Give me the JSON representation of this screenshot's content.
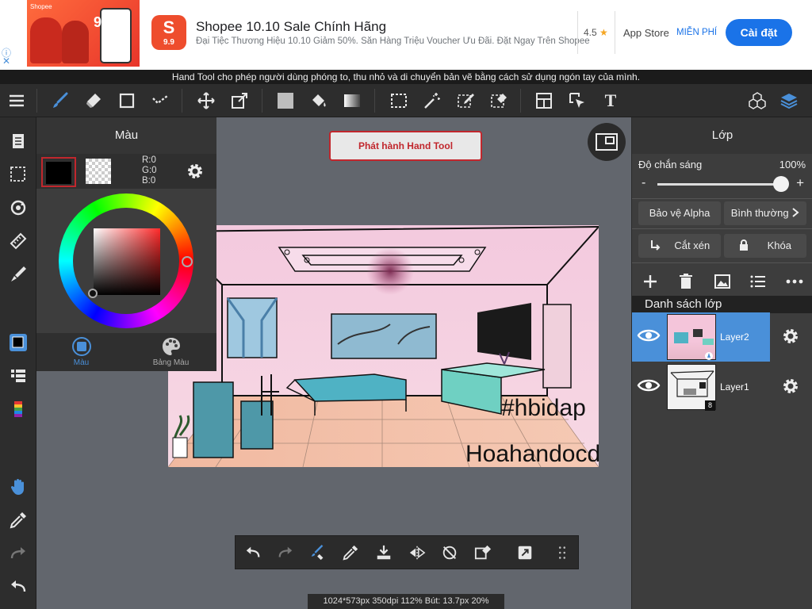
{
  "ad": {
    "info_icon": "ⓘ",
    "close_icon": "✕",
    "title": "Shopee 10.10 Sale Chính Hãng",
    "subtitle": "Đại Tiệc Thương Hiệu 10.10 Giảm 50%. Săn Hàng Triệu Voucher Ưu Đãi. Đặt Ngay Trên Shopee",
    "rating": "4.5",
    "star": "★",
    "store": "App Store",
    "price": "MIỄN PHÍ",
    "install": "Cài đặt",
    "logo_glyph": "S",
    "logo_text": "9.9",
    "image_brand": "Shopee",
    "image_number": "9.9"
  },
  "hint": "Hand Tool cho phép người dùng phóng to, thu nhỏ và di chuyển bản vẽ bằng cách sử dụng ngón tay của mình.",
  "toolbar": {
    "text_tool_glyph": "T",
    "accent": "#4a90d9"
  },
  "color_panel": {
    "title": "Màu",
    "rgb_r": "R:0",
    "rgb_g": "G:0",
    "rgb_b": "B:0",
    "tab_color": "Màu",
    "tab_palette": "Bảng Màu"
  },
  "canvas": {
    "release_button": "Phát hành Hand Tool",
    "status": "1024*573px 350dpi 112% Bút: 13.7px 20%"
  },
  "layer_panel": {
    "title": "Lớp",
    "opacity_label": "Độ chắn sáng",
    "opacity_value": "100%",
    "opacity_fraction": 1.0,
    "minus": "-",
    "plus": "+",
    "alpha_protect": "Bảo vệ Alpha",
    "blend_mode": "Bình thường",
    "clipping": "Cắt xén",
    "lock": "Khóa",
    "list_title": "Danh sách lớp",
    "layers": [
      {
        "name": "Layer2",
        "selected": true
      },
      {
        "name": "Layer1",
        "selected": false,
        "badge": "8"
      }
    ]
  },
  "drawing_text": {
    "signature": "Hoahandocdo",
    "hashtag": "#hbidap"
  }
}
